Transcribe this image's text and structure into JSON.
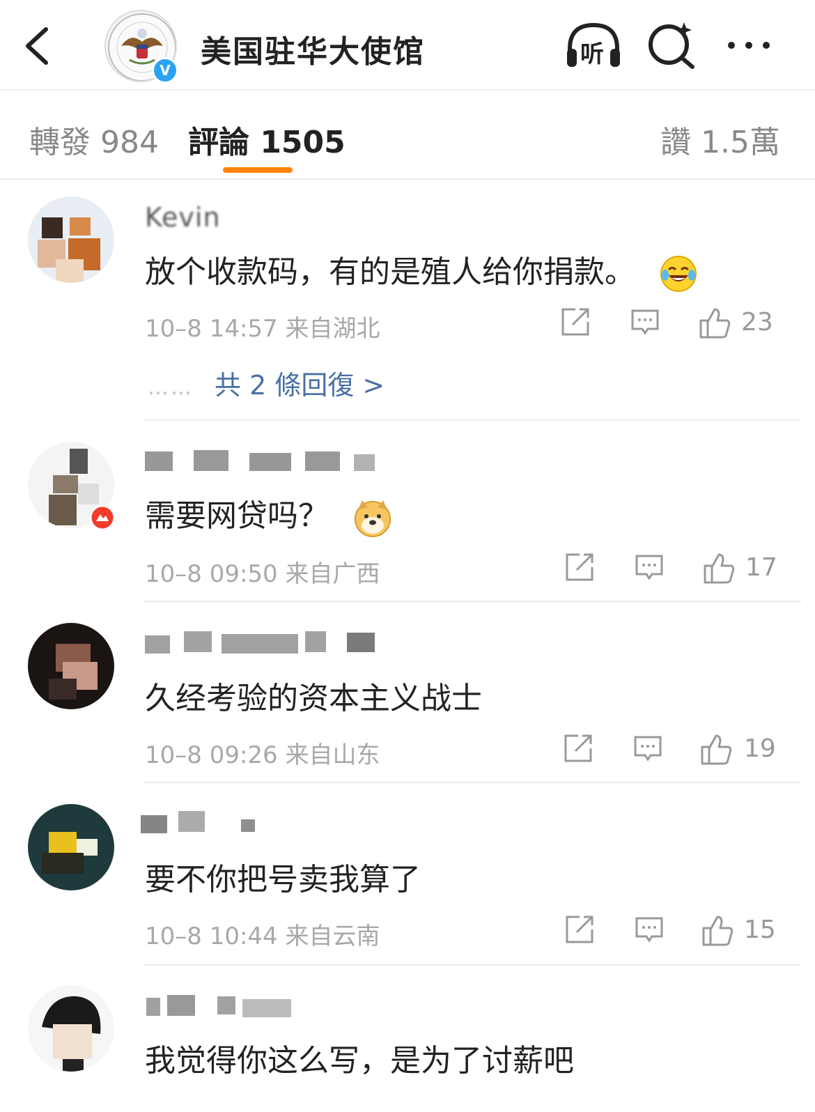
{
  "header": {
    "account_name": "美国驻华大使馆",
    "verified_mark": "V",
    "listen_label": "听",
    "icons": [
      "back-arrow-icon",
      "account-avatar",
      "listen-headphones-icon",
      "search-icon",
      "more-icon"
    ]
  },
  "tabs": {
    "repost_label": "轉發 984",
    "comments_label": "評論 1505",
    "likes_label": "讚 1.5萬",
    "active": "comments",
    "accent_color": "#ff8200"
  },
  "comments": [
    {
      "name": "Kevin",
      "text": "放个收款码，有的是殖人给你捐款。",
      "emoji": "laughing-tears-emoji",
      "meta": "10–8 14:57  来自湖北",
      "likes": "23",
      "replies": "共 2 條回復 >",
      "reply_dots": "……"
    },
    {
      "name": "",
      "text": "需要网贷吗？",
      "emoji": "doge-emoji",
      "meta": "10–8 09:50  来自广西",
      "likes": "17"
    },
    {
      "name": "",
      "text": "久经考验的资本主义战士",
      "meta": "10–8 09:26  来自山东",
      "likes": "19"
    },
    {
      "name": "",
      "text": "要不你把号卖我算了",
      "meta": "10–8 10:44  来自云南",
      "likes": "15"
    },
    {
      "name": "",
      "text": "我觉得你这么写，是为了讨薪吧"
    }
  ],
  "colors": {
    "link_blue": "#4a6fa5",
    "meta_gray": "#a8a8a8",
    "verify_blue": "#2aa3f2"
  }
}
